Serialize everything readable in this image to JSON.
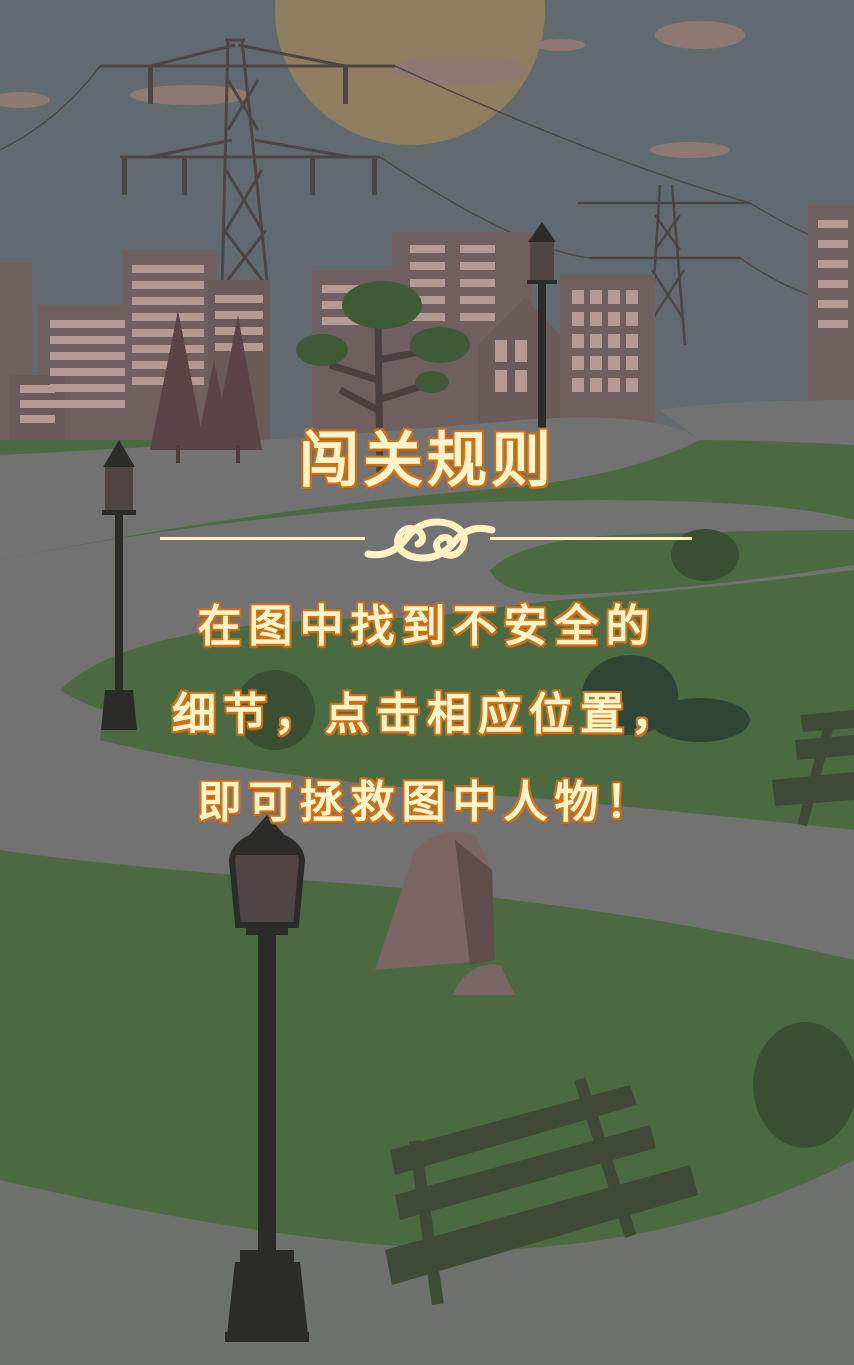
{
  "title": "闯关规则",
  "rules": {
    "line1": "在图中找到不安全的",
    "line2": "细节，点击相应位置，",
    "line3": "即可拯救图中人物！"
  },
  "colors": {
    "sky": "#616b6f",
    "sun": "#8f7e5f",
    "building": "#6f5f5f",
    "window": "#b39a92",
    "grass": "#4c6a42",
    "path": "#727272",
    "title_text": "#fff4c8",
    "text_outline": "#c9731c"
  },
  "scene": {
    "objects": [
      "sun",
      "power-towers",
      "city-buildings",
      "pine-trees",
      "park-tree",
      "street-lamps",
      "rocks",
      "benches",
      "bushes",
      "path"
    ]
  }
}
